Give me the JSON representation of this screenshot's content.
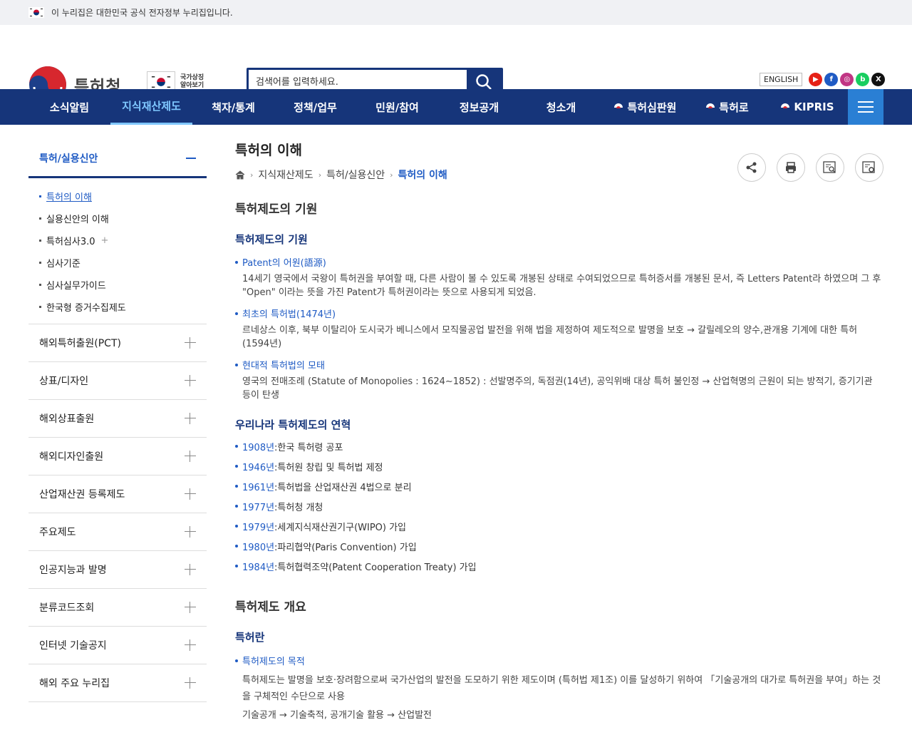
{
  "top_notice": "이 누리집은 대한민국 공식 전자정부 누리집입니다.",
  "header": {
    "logo_text": "특허청",
    "symbols_line1": "국가상징",
    "symbols_line2": "알아보기",
    "search_placeholder": "검색어를 입력하세요.",
    "english_label": "ENGLISH",
    "sns_icons": [
      "youtube-icon",
      "facebook-icon",
      "instagram-icon",
      "blog-icon",
      "x-icon"
    ]
  },
  "nav": {
    "items": [
      "소식알림",
      "지식재산제도",
      "책자/통계",
      "정책/업무",
      "민원/참여",
      "정보공개",
      "청소개",
      "특허심판원",
      "특허로",
      "KIPRIS"
    ],
    "active_index": 1
  },
  "sidebar": {
    "open_title": "특허/실용신안",
    "sub_items": [
      "특허의 이해",
      "실용신안의 이해",
      "특허심사3.0",
      "심사기준",
      "심사실무가이드",
      "한국형 증거수집제도"
    ],
    "active_sub_index": 0,
    "rows": [
      "해외특허출원(PCT)",
      "상표/디자인",
      "해외상표출원",
      "해외디자인출원",
      "산업재산권 등록제도",
      "주요제도",
      "인공지능과 발명",
      "분류코드조회",
      "인터넷 기술공지",
      "해외 주요 누리집"
    ]
  },
  "content": {
    "page_title": "특허의 이해",
    "breadcrumb": [
      "지식재산제도",
      "특허/실용신안",
      "특허의 이해"
    ],
    "section1_title": "특허제도의 기원",
    "sub1_title": "특허제도의 기원",
    "items": [
      {
        "label": "Patent의 어원(語源)",
        "desc": "14세기 영국에서 국왕이 특허권을 부여할 때, 다른 사람이 볼 수 있도록 개봉된 상태로 수여되었으므로 특허증서를 개봉된 문서, 즉 Letters Patent라 하였으며 그 후 \"Open\" 이라는 뜻을 가진 Patent가 특허권이라는 뜻으로 사용되게 되었음."
      },
      {
        "label": "최초의 특허법(1474년)",
        "desc": "르네상스 이후, 북부 이탈리아 도시국가 베니스에서 모직물공업 발전을 위해 법을 제정하여 제도적으로 발명을 보호 → 갈릴레오의 양수,관개용 기계에 대한 특허 (1594년)"
      },
      {
        "label": "현대적 특허법의 모태",
        "desc": "영국의 전매조례 (Statute of Monopolies : 1624∼1852) : 선발명주의, 독점권(14년), 공익위배 대상 특허 불인정 → 산업혁명의 근원이 되는 방적기, 증기기관 등이 탄생"
      }
    ],
    "sub2_title": "우리나라 특허제도의 연혁",
    "history": [
      {
        "year": "1908년",
        "text": " :한국 특허령 공포"
      },
      {
        "year": "1946년",
        "text": " :특허원 창립 및 특허법 제정"
      },
      {
        "year": "1961년",
        "text": " :특허법을 산업재산권 4법으로 분리"
      },
      {
        "year": "1977년",
        "text": " :특허청 개청"
      },
      {
        "year": "1979년",
        "text": " :세계지식재산권기구(WIPO) 가입"
      },
      {
        "year": "1980년",
        "text": " :파리협약(Paris Convention) 가입"
      },
      {
        "year": "1984년",
        "text": " :특허협력조약(Patent Cooperation Treaty) 가입"
      }
    ],
    "section2_title": "특허제도 개요",
    "sub3_title": "특허란",
    "purpose_label": "특허제도의 목적",
    "purpose_desc": "특허제도는 발명을 보호·장려함으로써 국가산업의 발전을 도모하기 위한 제도이며 (특허법 제1조) 이를 달성하기 위하여 「기술공개의 대가로 특허권을 부여」하는 것을 구체적인 수단으로 사용",
    "purpose_flow": "기술공개 → 기술축적, 공개기술 활용 → 산업발전"
  },
  "colors": {
    "navy": "#16357a",
    "link_blue": "#1f5bc4",
    "active_nav": "#7fc7ff"
  }
}
